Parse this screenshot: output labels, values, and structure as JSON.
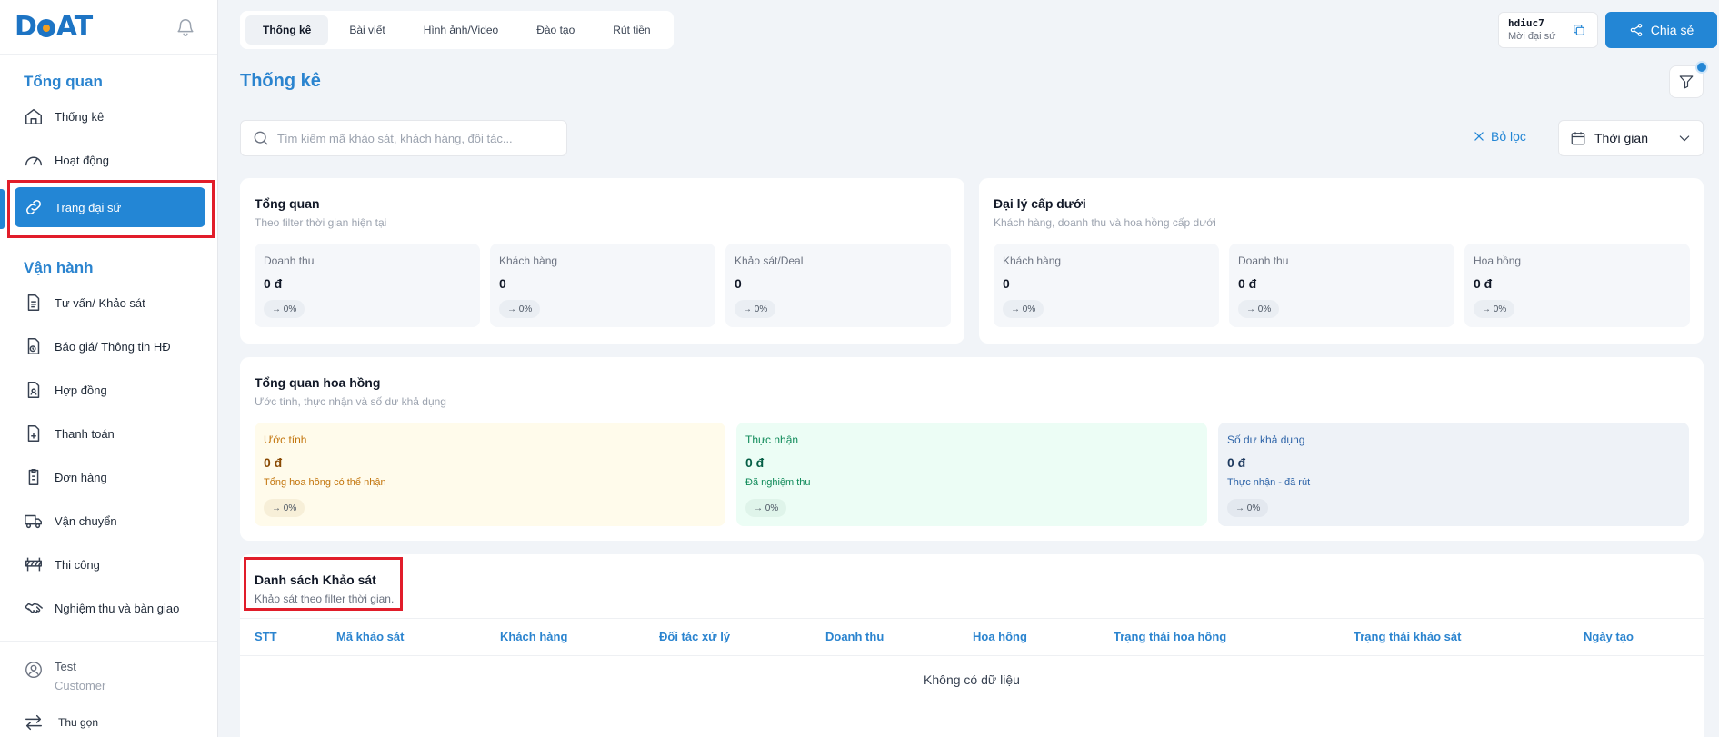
{
  "brand": {
    "logo_text_left": "D",
    "logo_text_right": "AT"
  },
  "sidebar": {
    "section_overview": "Tổng quan",
    "overview_items": [
      {
        "label": "Thống kê",
        "icon": "home-icon"
      },
      {
        "label": "Hoạt động",
        "icon": "gauge-icon"
      },
      {
        "label": "Trang đại sứ",
        "icon": "link-icon",
        "active": true
      }
    ],
    "section_operation": "Vận hành",
    "operation_items": [
      {
        "label": "Tư vấn/ Khảo sát",
        "icon": "document-icon"
      },
      {
        "label": "Báo giá/ Thông tin HĐ",
        "icon": "document-clock-icon"
      },
      {
        "label": "Hợp đồng",
        "icon": "document-user-icon"
      },
      {
        "label": "Thanh toán",
        "icon": "document-plus-icon"
      },
      {
        "label": "Đơn hàng",
        "icon": "clipboard-icon"
      },
      {
        "label": "Vận chuyển",
        "icon": "truck-icon"
      },
      {
        "label": "Thi công",
        "icon": "barrier-icon"
      },
      {
        "label": "Nghiệm thu và bàn giao",
        "icon": "handshake-icon"
      }
    ],
    "user": {
      "name": "Test",
      "role": "Customer"
    },
    "collapse_label": "Thu gọn"
  },
  "tabs": [
    {
      "label": "Thống kê",
      "active": true
    },
    {
      "label": "Bài viết"
    },
    {
      "label": "Hình ảnh/Video"
    },
    {
      "label": "Đào tạo"
    },
    {
      "label": "Rút tiền"
    }
  ],
  "header": {
    "agent_code": "hdiuc7",
    "agent_label": "Mời đại sứ",
    "share_label": "Chia sẻ"
  },
  "page": {
    "title": "Thống kê",
    "search_placeholder": "Tìm kiếm mã khảo sát, khách hàng, đối tác...",
    "clear_filter_label": "Bỏ lọc",
    "time_label": "Thời gian"
  },
  "overview": {
    "title": "Tổng quan",
    "subtitle": "Theo filter thời gian hiện tại",
    "stats": [
      {
        "label": "Doanh thu",
        "value": "0 đ",
        "change": "→ 0%"
      },
      {
        "label": "Khách hàng",
        "value": "0",
        "change": "→ 0%"
      },
      {
        "label": "Khảo sát/Deal",
        "value": "0",
        "change": "→ 0%"
      }
    ]
  },
  "sub_agents": {
    "title": "Đại lý cấp dưới",
    "subtitle": "Khách hàng, doanh thu và hoa hồng cấp dưới",
    "stats": [
      {
        "label": "Khách hàng",
        "value": "0",
        "change": "→ 0%"
      },
      {
        "label": "Doanh thu",
        "value": "0 đ",
        "change": "→ 0%"
      },
      {
        "label": "Hoa hồng",
        "value": "0 đ",
        "change": "→ 0%"
      }
    ]
  },
  "commission": {
    "title": "Tổng quan hoa hồng",
    "subtitle": "Ước tính, thực nhận và số dư khả dụng",
    "blocks": [
      {
        "label": "Ước tính",
        "value": "0 đ",
        "note": "Tổng hoa hồng có thể nhận",
        "change": "→ 0%"
      },
      {
        "label": "Thực nhận",
        "value": "0 đ",
        "note": "Đã nghiệm thu",
        "change": "→ 0%"
      },
      {
        "label": "Số dư khả dụng",
        "value": "0 đ",
        "note": "Thực nhận - đã rút",
        "change": "→ 0%"
      }
    ]
  },
  "survey_list": {
    "title": "Danh sách Khảo sát",
    "subtitle": "Khảo sát theo filter thời gian.",
    "columns": [
      "STT",
      "Mã khảo sát",
      "Khách hàng",
      "Đối tác xử lý",
      "Doanh thu",
      "Hoa hồng",
      "Trạng thái hoa hồng",
      "Trạng thái khảo sát",
      "Ngày tạo"
    ],
    "empty_text": "Không có dữ liệu"
  },
  "colors": {
    "accent": "#2386d5",
    "heading": "#2b84cf",
    "highlight": "#e11d2a"
  }
}
